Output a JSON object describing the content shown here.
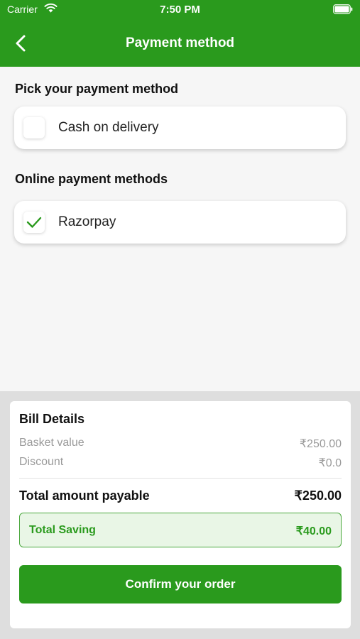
{
  "status_bar": {
    "carrier": "Carrier",
    "time": "7:50 PM"
  },
  "header": {
    "title": "Payment method",
    "back_icon": "chevron-left-icon"
  },
  "sections": {
    "pick_title": "Pick your payment method",
    "online_title": "Online payment methods"
  },
  "options": {
    "cash": {
      "label": "Cash on delivery",
      "checked": false
    },
    "razorpay": {
      "label": "Razorpay",
      "checked": true
    }
  },
  "bill": {
    "title": "Bill Details",
    "basket_label": "Basket value",
    "basket_value": "₹250.00",
    "discount_label": "Discount",
    "discount_value": "₹0.0",
    "total_label": "Total amount payable",
    "total_value": "₹250.00",
    "saving_label": "Total Saving",
    "saving_value": "₹40.00"
  },
  "confirm_label": "Confirm your order",
  "colors": {
    "accent": "#2a9a1d",
    "saving_bg": "#e9f6e6"
  }
}
